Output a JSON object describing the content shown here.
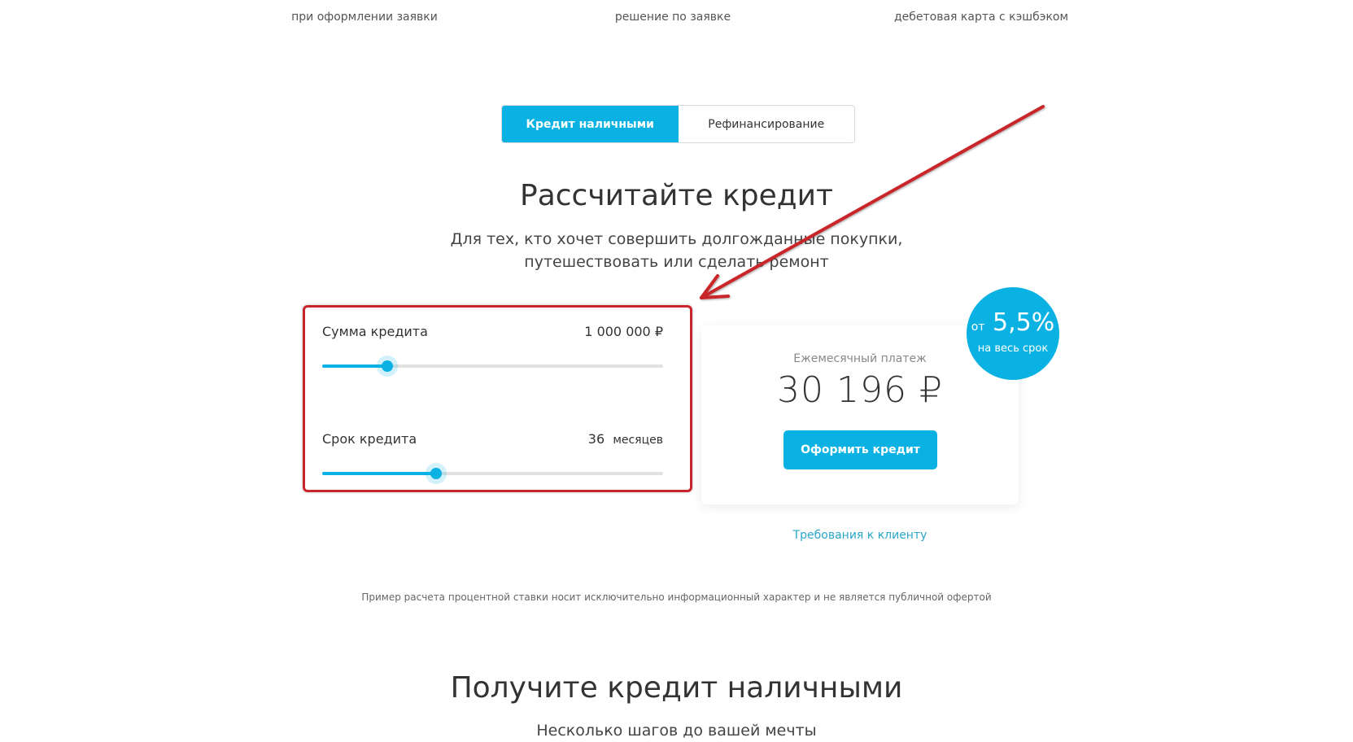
{
  "features": [
    {
      "caption": "при оформлении заявки"
    },
    {
      "caption": "решение по заявке"
    },
    {
      "caption": "дебетовая карта с кэшбэком"
    }
  ],
  "tabs": [
    {
      "label": "Кредит наличными",
      "active": true
    },
    {
      "label": "Рефинансирование",
      "active": false
    }
  ],
  "calculator": {
    "title": "Рассчитайте кредит",
    "subtitle_line1": "Для тех, кто хочет совершить долгожданные покупки,",
    "subtitle_line2": "путешествовать или сделать ремонт",
    "amount": {
      "label": "Сумма кредита",
      "value": "1 000 000 ₽",
      "slider_fraction": 0.19
    },
    "term": {
      "label": "Срок кредита",
      "value": "36",
      "unit": "месяцев",
      "slider_fraction": 0.335
    }
  },
  "result": {
    "monthly_label": "Ежемесячный платеж",
    "monthly_value": "30 196 ₽",
    "cta_label": "Оформить кредит",
    "requirements_link": "Требования к клиенту"
  },
  "badge": {
    "prefix": "от",
    "rate": "5,5%",
    "note": "на весь срок"
  },
  "disclaimer": "Пример расчета процентной ставки носит исключительно информационный характер и не является публичной офертой",
  "next_section": {
    "title": "Получите кредит наличными",
    "subtitle": "Несколько шагов до вашей мечты"
  },
  "colors": {
    "accent": "#0ab2e3",
    "annotation": "#c9252c"
  }
}
